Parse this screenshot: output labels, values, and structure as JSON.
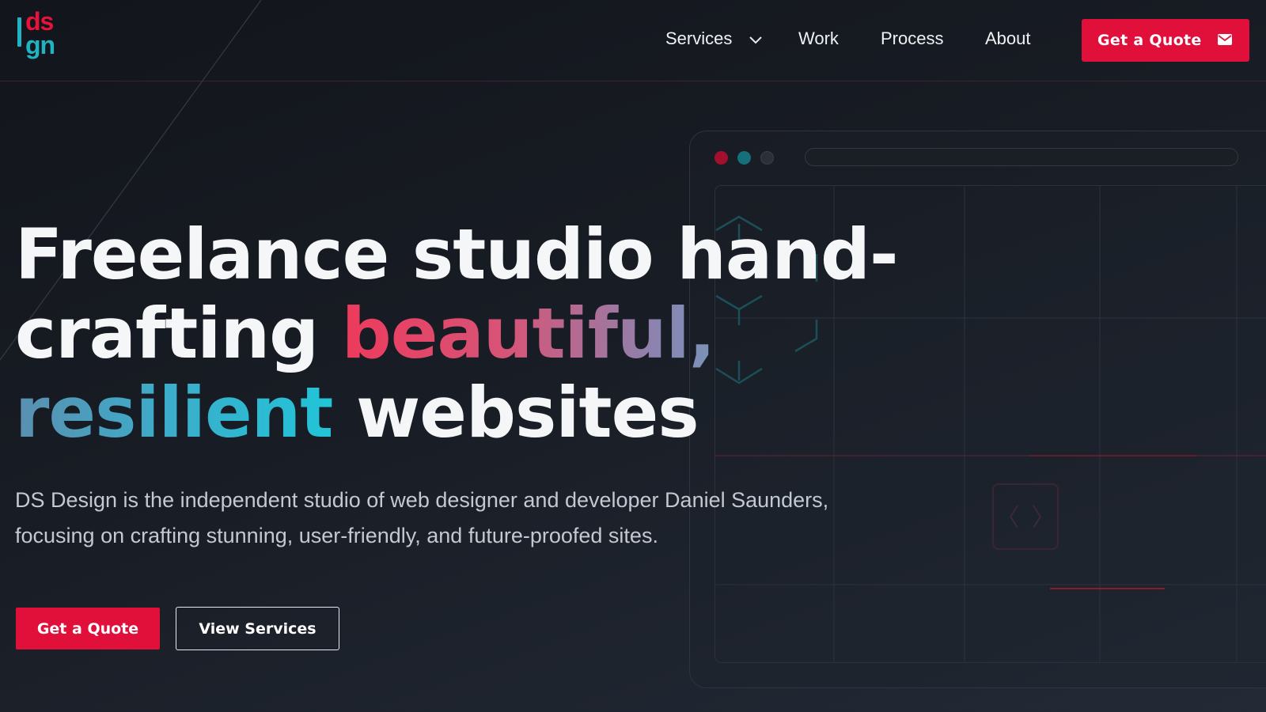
{
  "logo": {
    "top": "ds",
    "bottom": "gn"
  },
  "nav": {
    "services": "Services",
    "work": "Work",
    "process": "Process",
    "about": "About",
    "quote_button": "Get a Quote"
  },
  "hero": {
    "title_part1": "Freelance studio hand-",
    "title_part2": "crafting ",
    "title_highlight1": "beautiful,",
    "title_highlight2": "resilient",
    "title_part3": " websites",
    "subtitle_line1": "DS Design is the independent studio of web designer and developer Daniel Saunders,",
    "subtitle_line2": "focusing on crafting stunning, user-friendly, and future-proofed sites.",
    "primary_button": "Get a Quote",
    "secondary_button": "View Services"
  },
  "colors": {
    "accent_red": "#e0103a",
    "accent_teal": "#20b3c4",
    "background": "#181c24"
  },
  "icons": [
    "chevron-down-icon",
    "mail-icon",
    "code-icon",
    "hexagon-icon"
  ]
}
